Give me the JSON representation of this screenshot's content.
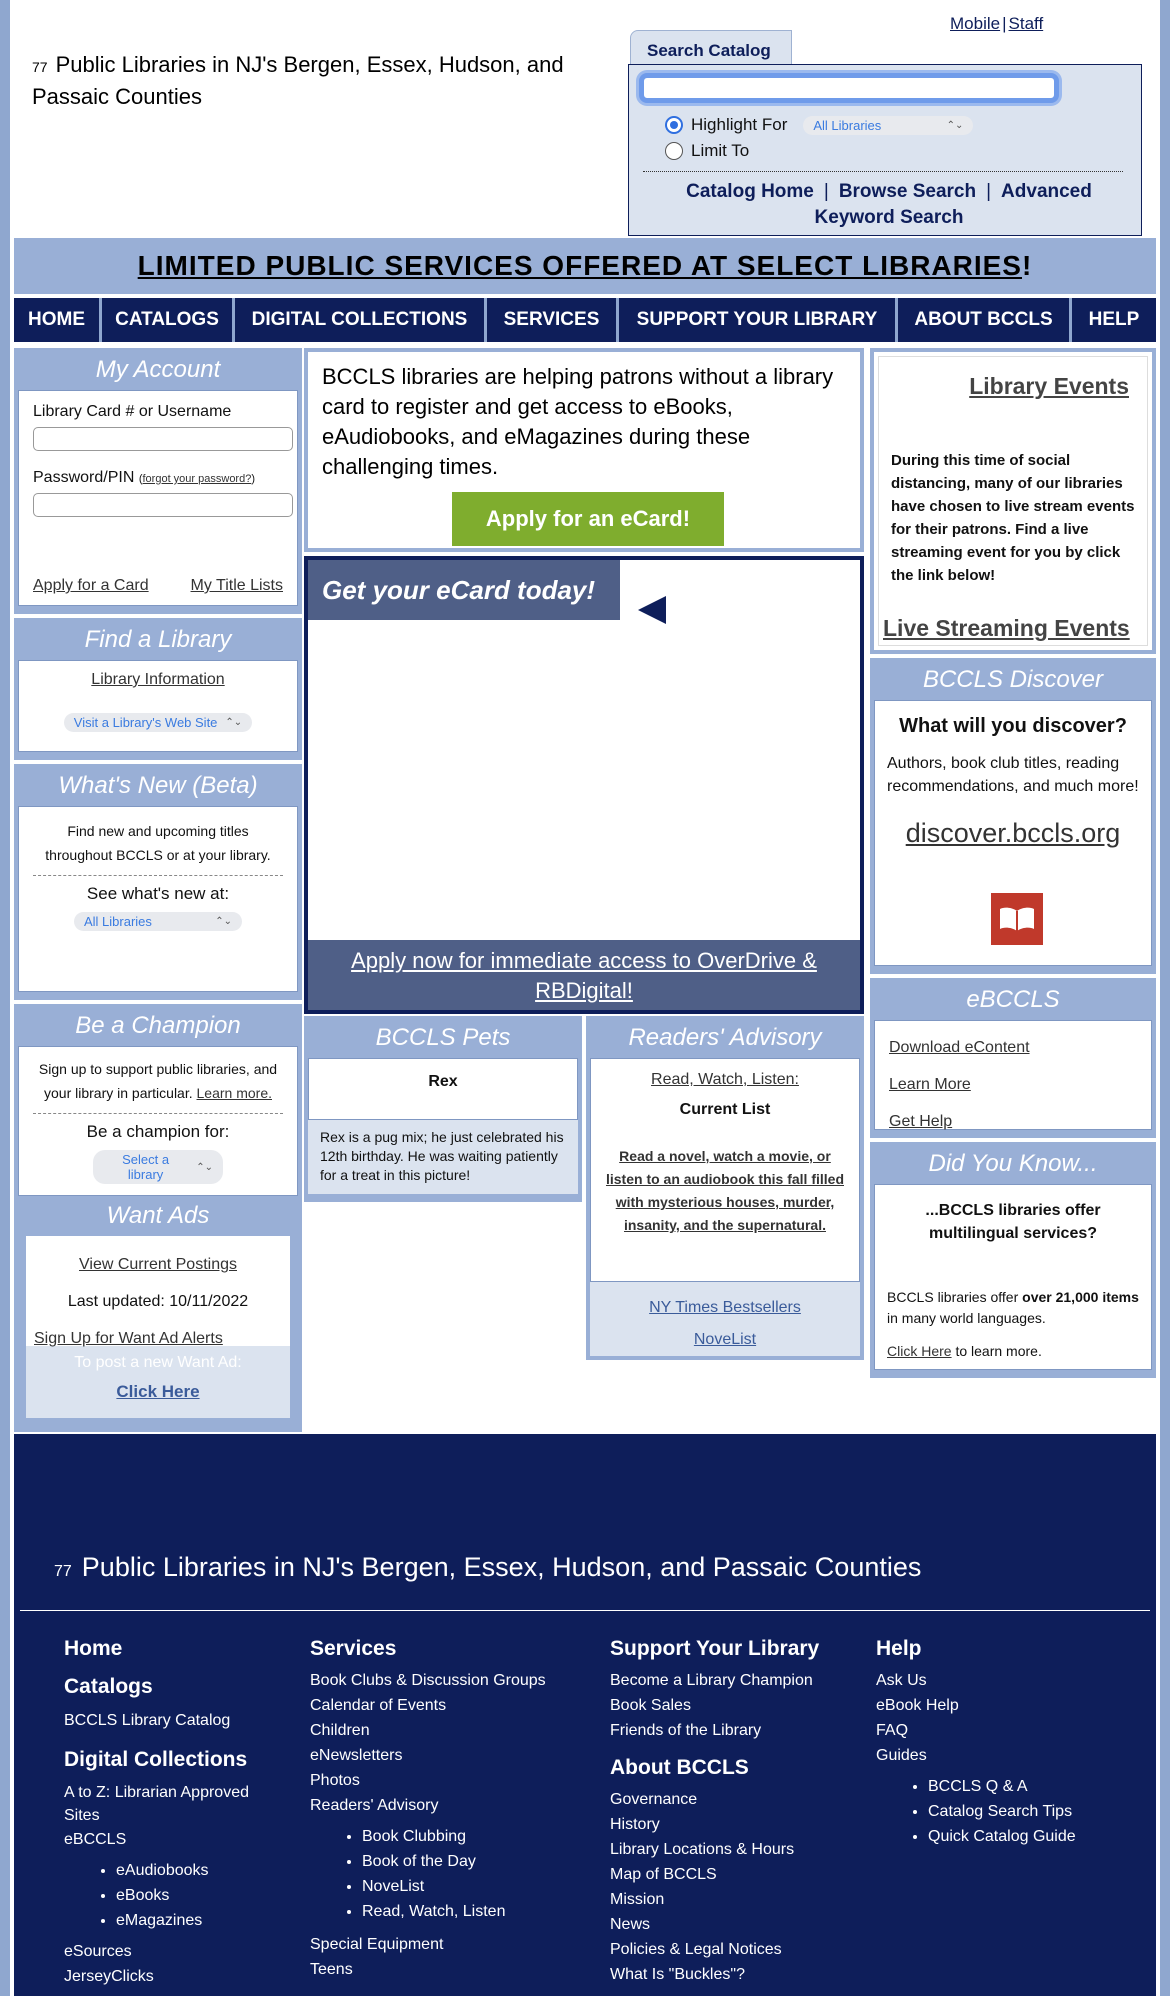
{
  "header": {
    "count": "77",
    "title": "Public Libraries in NJ's Bergen, Essex, Hudson, and Passaic Counties",
    "mobile": "Mobile",
    "staff": "Staff"
  },
  "search": {
    "tab": "Search Catalog",
    "highlight": "Highlight For",
    "limit": "Limit To",
    "libraries_select": "All Libraries",
    "catalog_home": "Catalog Home",
    "browse": "Browse Search",
    "advanced": "Advanced Keyword Search"
  },
  "banner": {
    "text": "LIMITED PUBLIC SERVICES OFFERED AT SELECT LIBRARIES",
    "bang": "!"
  },
  "nav": [
    "HOME",
    "CATALOGS",
    "DIGITAL COLLECTIONS",
    "SERVICES",
    "SUPPORT YOUR LIBRARY",
    "ABOUT BCCLS",
    "HELP"
  ],
  "account": {
    "title": "My Account",
    "card_label": "Library Card # or Username",
    "pin_label": "Password/PIN",
    "forgot": "forgot your password?",
    "apply": "Apply for a Card",
    "lists": "My Title Lists"
  },
  "find": {
    "title": "Find a Library",
    "info": "Library Information",
    "visit": "Visit a Library's Web Site"
  },
  "whatsnew": {
    "title": "What's New (Beta)",
    "text": "Find new and upcoming titles throughout BCCLS or at your library.",
    "see": "See what's new at:",
    "select": "All Libraries"
  },
  "champion": {
    "title": "Be a Champion",
    "text": "Sign up to support public libraries, and your library in particular.",
    "learn": "Learn more.",
    "for": "Be a champion for:",
    "select": "Select a library"
  },
  "wantads": {
    "title": "Want Ads",
    "view": "View Current Postings",
    "updated": "Last updated: 10/11/2022",
    "signup": "Sign Up for Want Ad Alerts",
    "post": "To post a new Want Ad:",
    "click": "Click Here"
  },
  "ecard": {
    "text": "BCCLS libraries are helping patrons without a library card to register and get access to eBooks, eAudiobooks, and eMagazines during these challenging times.",
    "button": "Apply for an eCard!",
    "video_title": "Get your eCard today!",
    "video_footer": "Apply now for immediate access to OverDrive & RBDigital!"
  },
  "pets": {
    "title": "BCCLS Pets",
    "name": "Rex",
    "caption": "Rex is a pug mix; he just celebrated his 12th birthday. He was waiting patiently for a treat in this picture!"
  },
  "advisory": {
    "title": "Readers' Advisory",
    "rwl": "Read, Watch, Listen:",
    "current": "Current List",
    "blurb": "Read a novel, watch a movie, or listen to an audiobook this fall filled with mysterious houses, murder, insanity, and the supernatural.",
    "nyt": "NY Times Bestsellers",
    "novelist": "NoveList"
  },
  "events": {
    "title": "Library Events",
    "text": "During this time of social distancing, many of our libraries have chosen to live stream events for their patrons. Find a live streaming event for you by click the link below!",
    "link": "Live Streaming Events"
  },
  "discover": {
    "title": "BCCLS Discover",
    "heading": "What will you discover?",
    "text": "Authors, book club titles, reading recommendations, and much more!",
    "url": "discover.bccls.org",
    "icon": "book-icon"
  },
  "ebccls": {
    "title": "eBCCLS",
    "links": [
      "Download eContent",
      "Learn More",
      "Get Help"
    ]
  },
  "didyouknow": {
    "title": "Did You Know...",
    "heading": "...BCCLS libraries offer multilingual services?",
    "text_a": "BCCLS libraries offer ",
    "text_b": "over 21,000 items",
    "text_c": " in many world languages.",
    "click": "Click Here",
    "more": " to learn more."
  },
  "footer": {
    "count": "77",
    "title": "Public Libraries in NJ's Bergen, Essex, Hudson, and Passaic Counties",
    "col1": {
      "home": "Home",
      "catalogs": "Catalogs",
      "catalog_link": "BCCLS Library Catalog",
      "digital": "Digital Collections",
      "atoz": "A to Z: Librarian Approved Sites",
      "ebccls": "eBCCLS",
      "sub": [
        "eAudiobooks",
        "eBooks",
        "eMagazines"
      ],
      "esources": "eSources",
      "jersey": "JerseyClicks"
    },
    "col2": {
      "services": "Services",
      "items": [
        "Book Clubs & Discussion Groups",
        "Calendar of Events",
        "Children",
        "eNewsletters",
        "Photos",
        "Readers' Advisory"
      ],
      "sub": [
        "Book Clubbing",
        "Book of the Day",
        "NoveList",
        "Read, Watch, Listen"
      ],
      "after": [
        "Special Equipment",
        "Teens"
      ]
    },
    "col3": {
      "support": "Support Your Library",
      "items": [
        "Become a Library Champion",
        "Book Sales",
        "Friends of the Library"
      ],
      "about": "About BCCLS",
      "about_items": [
        "Governance",
        "History",
        "Library Locations & Hours",
        "Map of BCCLS",
        "Mission",
        "News",
        "Policies & Legal Notices",
        "What Is \"Buckles\"?"
      ]
    },
    "col4": {
      "help": "Help",
      "items": [
        "Ask Us",
        "eBook Help",
        "FAQ",
        "Guides"
      ],
      "sub": [
        "BCCLS Q & A",
        "Catalog Search Tips",
        "Quick Catalog Guide"
      ]
    }
  }
}
